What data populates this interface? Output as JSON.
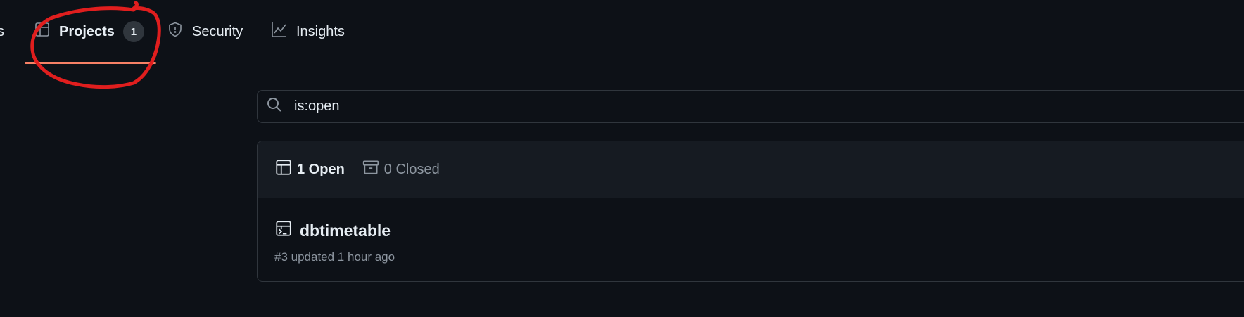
{
  "nav": {
    "partial_label": "s",
    "projects_label": "Projects",
    "projects_count": "1",
    "security_label": "Security",
    "insights_label": "Insights"
  },
  "search": {
    "value": "is:open"
  },
  "filters": {
    "open_label": "1 Open",
    "closed_label": "0 Closed"
  },
  "projects": [
    {
      "title": "dbtimetable",
      "meta": "#3 updated 1 hour ago"
    }
  ],
  "colors": {
    "background": "#0d1117",
    "header_bg": "#161b22",
    "border": "#30363d",
    "underline": "#f78166",
    "annotation": "#e01e1e"
  }
}
